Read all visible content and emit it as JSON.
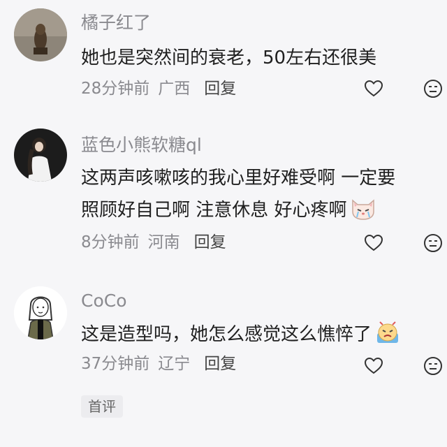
{
  "comments": [
    {
      "username": "橘子红了",
      "lines": [
        "她也是突然间的衰老，50左右还很美"
      ],
      "time": "28分钟前",
      "location": "广西",
      "reply_label": "回复"
    },
    {
      "username": "蓝色小熊软糖ql",
      "lines": [
        "这两声咳嗽咳的我心里好难受啊 一定要",
        "照顾好自己啊 注意休息 好心疼啊"
      ],
      "time": "8分钟前",
      "location": "河南",
      "reply_label": "回复"
    },
    {
      "username": "CoCo",
      "lines": [
        "这是造型吗，她怎么感觉这么憔悴了"
      ],
      "time": "37分钟前",
      "location": "辽宁",
      "reply_label": "回复"
    }
  ],
  "badge": {
    "label": "首评"
  },
  "icons": {
    "like": "heart-icon",
    "dislike": "neutral-face-icon",
    "emoji_cat": "crying-cat-emoji",
    "emoji_sad": "sad-face-emoji"
  },
  "colors": {
    "background": "#f6f6f8",
    "meta": "#8a8a8f",
    "text": "#1f1f1f"
  }
}
